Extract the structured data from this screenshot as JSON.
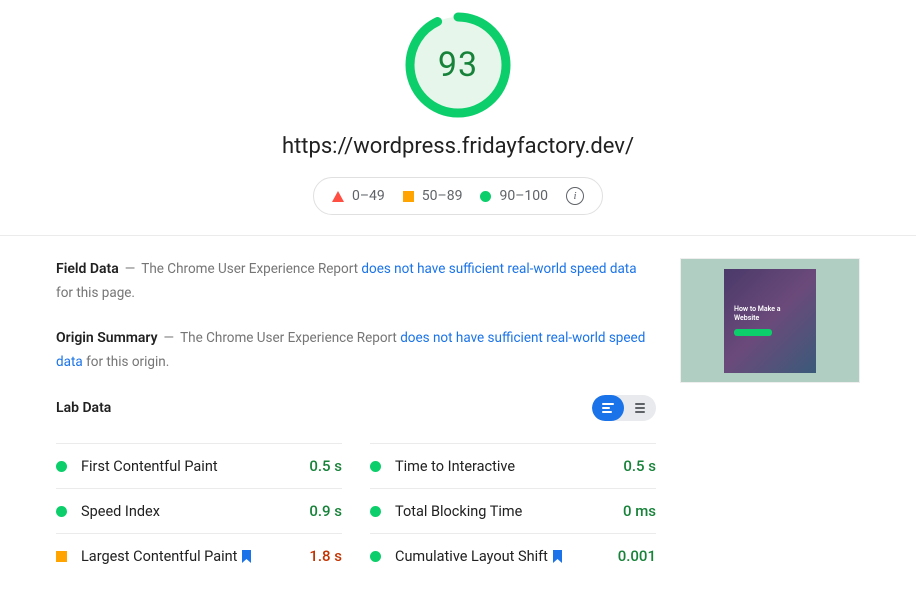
{
  "score": "93",
  "url": "https://wordpress.fridayfactory.dev/",
  "legend": {
    "poor": "0–49",
    "avg": "50–89",
    "good": "90–100"
  },
  "field_data": {
    "title": "Field Data",
    "prefix": "The Chrome User Experience Report ",
    "link": "does not have sufficient real-world speed data",
    "suffix": " for this page."
  },
  "origin_summary": {
    "title": "Origin Summary",
    "prefix": "The Chrome User Experience Report ",
    "link": "does not have sufficient real-world speed data",
    "suffix": " for this origin."
  },
  "thumb": {
    "line1": "How to Make a",
    "line2": "Website"
  },
  "lab_data_title": "Lab Data",
  "metrics": {
    "left": [
      {
        "name": "First Contentful Paint",
        "value": "0.5 s",
        "status": "g",
        "flag": false
      },
      {
        "name": "Speed Index",
        "value": "0.9 s",
        "status": "g",
        "flag": false
      },
      {
        "name": "Largest Contentful Paint",
        "value": "1.8 s",
        "status": "o",
        "flag": true
      }
    ],
    "right": [
      {
        "name": "Time to Interactive",
        "value": "0.5 s",
        "status": "g",
        "flag": false
      },
      {
        "name": "Total Blocking Time",
        "value": "0 ms",
        "status": "g",
        "flag": false
      },
      {
        "name": "Cumulative Layout Shift",
        "value": "0.001",
        "status": "g",
        "flag": true
      }
    ]
  }
}
